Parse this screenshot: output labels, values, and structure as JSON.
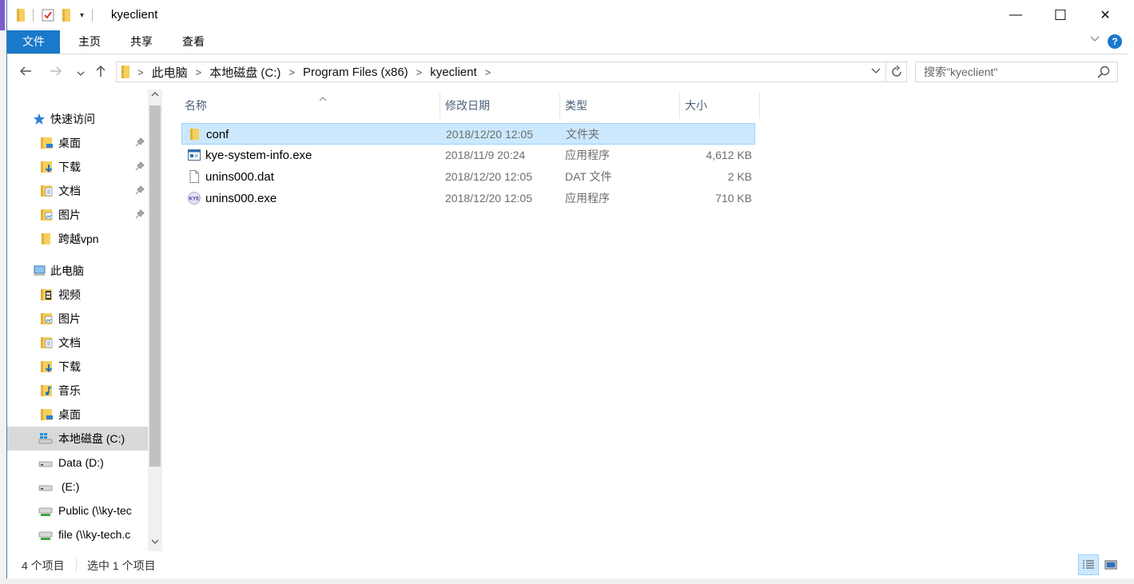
{
  "window": {
    "title": "kyeclient",
    "controls": {
      "minimize": "—",
      "maximize": "☐",
      "close": "✕"
    }
  },
  "ribbon": {
    "tabs": [
      {
        "label": "文件"
      },
      {
        "label": "主页"
      },
      {
        "label": "共享"
      },
      {
        "label": "查看"
      }
    ],
    "help": "?"
  },
  "address": {
    "breadcrumbs": [
      "此电脑",
      "本地磁盘 (C:)",
      "Program Files (x86)",
      "kyeclient"
    ]
  },
  "search": {
    "placeholder": "搜索\"kyeclient\""
  },
  "navpane": {
    "quick_access": {
      "label": "快速访问",
      "items": [
        {
          "label": "桌面",
          "icon": "desktop-folder-icon",
          "pinned": true
        },
        {
          "label": "下载",
          "icon": "downloads-folder-icon",
          "pinned": true
        },
        {
          "label": "文档",
          "icon": "documents-folder-icon",
          "pinned": true
        },
        {
          "label": "图片",
          "icon": "pictures-folder-icon",
          "pinned": true
        },
        {
          "label": "跨越vpn",
          "icon": "folder-icon",
          "pinned": false
        }
      ]
    },
    "this_pc": {
      "label": "此电脑",
      "items": [
        {
          "label": "视频",
          "icon": "videos-folder-icon"
        },
        {
          "label": "图片",
          "icon": "pictures-folder-icon"
        },
        {
          "label": "文档",
          "icon": "documents-folder-icon"
        },
        {
          "label": "下载",
          "icon": "downloads-folder-icon"
        },
        {
          "label": "音乐",
          "icon": "music-folder-icon"
        },
        {
          "label": "桌面",
          "icon": "desktop-folder-icon"
        },
        {
          "label": "本地磁盘 (C:)",
          "icon": "windows-drive-icon",
          "selected": true
        },
        {
          "label": "Data (D:)",
          "icon": "drive-icon"
        },
        {
          "label": " (E:)",
          "icon": "drive-icon"
        },
        {
          "label": "Public (\\\\ky-tec",
          "icon": "network-drive-icon"
        },
        {
          "label": "file (\\\\ky-tech.c",
          "icon": "network-drive-icon"
        }
      ]
    }
  },
  "columns": {
    "name": "名称",
    "date": "修改日期",
    "type": "类型",
    "size": "大小"
  },
  "files": [
    {
      "name": "conf",
      "date": "2018/12/20 12:05",
      "type": "文件夹",
      "size": "",
      "icon": "folder-icon",
      "selected": true
    },
    {
      "name": "kye-system-info.exe",
      "date": "2018/11/9 20:24",
      "type": "应用程序",
      "size": "4,612 KB",
      "icon": "application-icon",
      "selected": false
    },
    {
      "name": "unins000.dat",
      "date": "2018/12/20 12:05",
      "type": "DAT 文件",
      "size": "2 KB",
      "icon": "file-icon",
      "selected": false
    },
    {
      "name": "unins000.exe",
      "date": "2018/12/20 12:05",
      "type": "应用程序",
      "size": "710 KB",
      "icon": "kye-app-icon",
      "selected": false
    }
  ],
  "status": {
    "item_count": "4 个项目",
    "selection": "选中 1 个项目"
  },
  "colors": {
    "accent": "#1979ca",
    "selection_bg": "#cce8ff",
    "selection_border": "#99d1ff",
    "nav_selected": "#d9d9d9"
  }
}
